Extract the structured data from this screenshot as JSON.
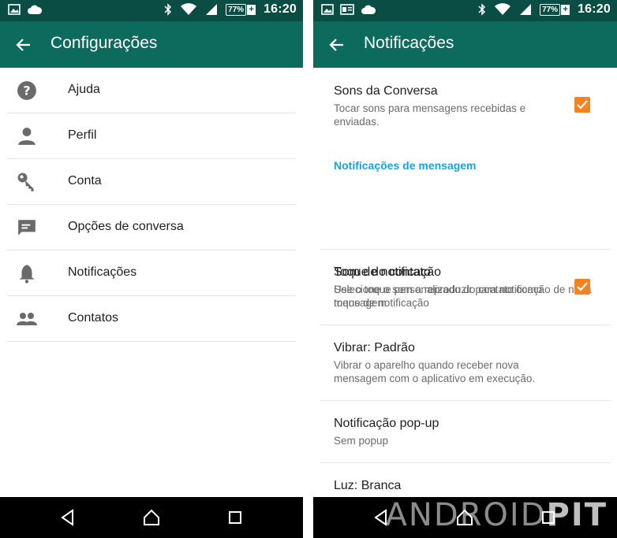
{
  "status": {
    "battery": "77%",
    "time": "16:20"
  },
  "left": {
    "title": "Configurações",
    "items": [
      {
        "label": "Ajuda",
        "icon": "help-circle-icon"
      },
      {
        "label": "Perfil",
        "icon": "person-icon"
      },
      {
        "label": "Conta",
        "icon": "key-icon"
      },
      {
        "label": "Opções de conversa",
        "icon": "chat-icon"
      },
      {
        "label": "Notificações",
        "icon": "bell-icon"
      },
      {
        "label": "Contatos",
        "icon": "group-icon"
      }
    ]
  },
  "right": {
    "title": "Notificações",
    "sons_title": "Sons da Conversa",
    "sons_sub": "Tocar sons para mensagens recebidas e enviadas.",
    "section": "Notificações de mensagem",
    "som_title": "Som de notificação",
    "som_sub": "Selecione o som a reproduzir para notificação de nova mensagem",
    "toque_title": "Toque do contato",
    "toque_sub": "Use o toque personalizado do contato como toque de notificação",
    "vibrar_title": "Vibrar: Padrão",
    "vibrar_sub": "Vibrar o aparelho quando receber nova mensagem com o aplicativo em execução.",
    "popup_title": "Notificação pop-up",
    "popup_sub": "Sem popup",
    "luz_title": "Luz: Branca"
  },
  "watermark": {
    "a": "ANDROID",
    "b": "PIT"
  },
  "colors": {
    "status_bar": "#0a4d44",
    "app_bar": "#0d6b5e",
    "checkbox": "#f5811f",
    "section": "#1ba1db"
  }
}
